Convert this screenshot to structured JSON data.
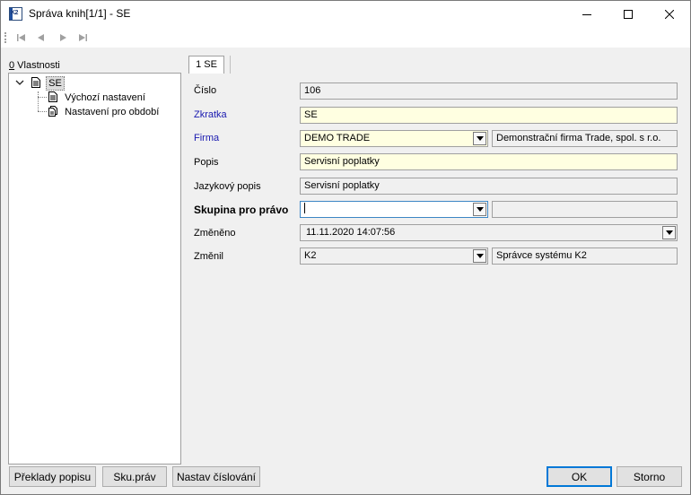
{
  "window": {
    "title": "Správa knih[1/1] - SE"
  },
  "icons": {
    "app": "k2-app-icon",
    "minimize": "minimize-icon",
    "maximize": "maximize-icon",
    "close": "close-icon",
    "first": "first-record-icon",
    "prev": "prev-record-icon",
    "next": "next-record-icon",
    "last": "last-record-icon",
    "doc": "document-icon",
    "expand": "chevron-down-icon"
  },
  "tree": {
    "header_underlined": "0",
    "header_rest": " Vlastnosti",
    "root": "SE",
    "children": [
      "Výchozí nastavení",
      "Nastavení pro období"
    ]
  },
  "tab": {
    "label": "1 SE"
  },
  "form": {
    "cislo": {
      "label": "Číslo",
      "value": "106"
    },
    "zkratka": {
      "label": "Zkratka",
      "value": "SE"
    },
    "firma": {
      "label": "Firma",
      "value": "DEMO TRADE",
      "description": "Demonstrační firma Trade, spol. s r.o."
    },
    "popis": {
      "label": "Popis",
      "value": "Servisní poplatky"
    },
    "jazykovy_popis": {
      "label": "Jazykový popis",
      "value": "Servisní poplatky"
    },
    "skupina": {
      "label": "Skupina pro právo",
      "value": "",
      "description": ""
    },
    "zmeneno": {
      "label": "Změněno",
      "value": "11.11.2020 14:07:56"
    },
    "zmenil": {
      "label": "Změnil",
      "value": "K2",
      "description": "Správce systému K2"
    }
  },
  "buttons": {
    "preklady": "Překlady popisu",
    "sku_prav": "Sku.práv",
    "nastav_cislovani": "Nastav číslování",
    "ok": "OK",
    "storno": "Storno"
  },
  "colors": {
    "required_bg": "#ffffe1",
    "readonly_bg": "#f0f0f0",
    "link_label": "#1a1ab0",
    "focus_border": "#3c86c4"
  }
}
